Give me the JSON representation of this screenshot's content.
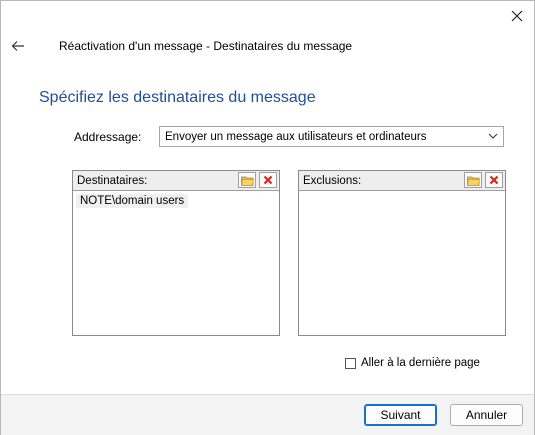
{
  "window": {
    "title": "Réactivation d'un message - Destinataires du message"
  },
  "page": {
    "heading": "Spécifiez les destinataires du message"
  },
  "addressing": {
    "label": "Addressage:",
    "selected": "Envoyer un message aux utilisateurs et ordinateurs"
  },
  "recipients": {
    "header": "Destinataires:",
    "items": [
      "NOTE\\domain users"
    ]
  },
  "exclusions": {
    "header": "Exclusions:",
    "items": []
  },
  "options": {
    "goto_last_page": "Aller à la dernière page",
    "goto_last_page_checked": false
  },
  "buttons": {
    "next": "Suivant",
    "cancel": "Annuler"
  },
  "icons": {
    "close": "close-icon",
    "back": "back-arrow-icon",
    "browse": "folder-icon",
    "remove": "delete-x-icon",
    "dropdown": "chevron-down-icon"
  },
  "colors": {
    "heading": "#1f4e9a",
    "primary_border": "#1a6fc9",
    "remove_icon": "#d9261c",
    "folder_icon": "#e8b93c"
  }
}
